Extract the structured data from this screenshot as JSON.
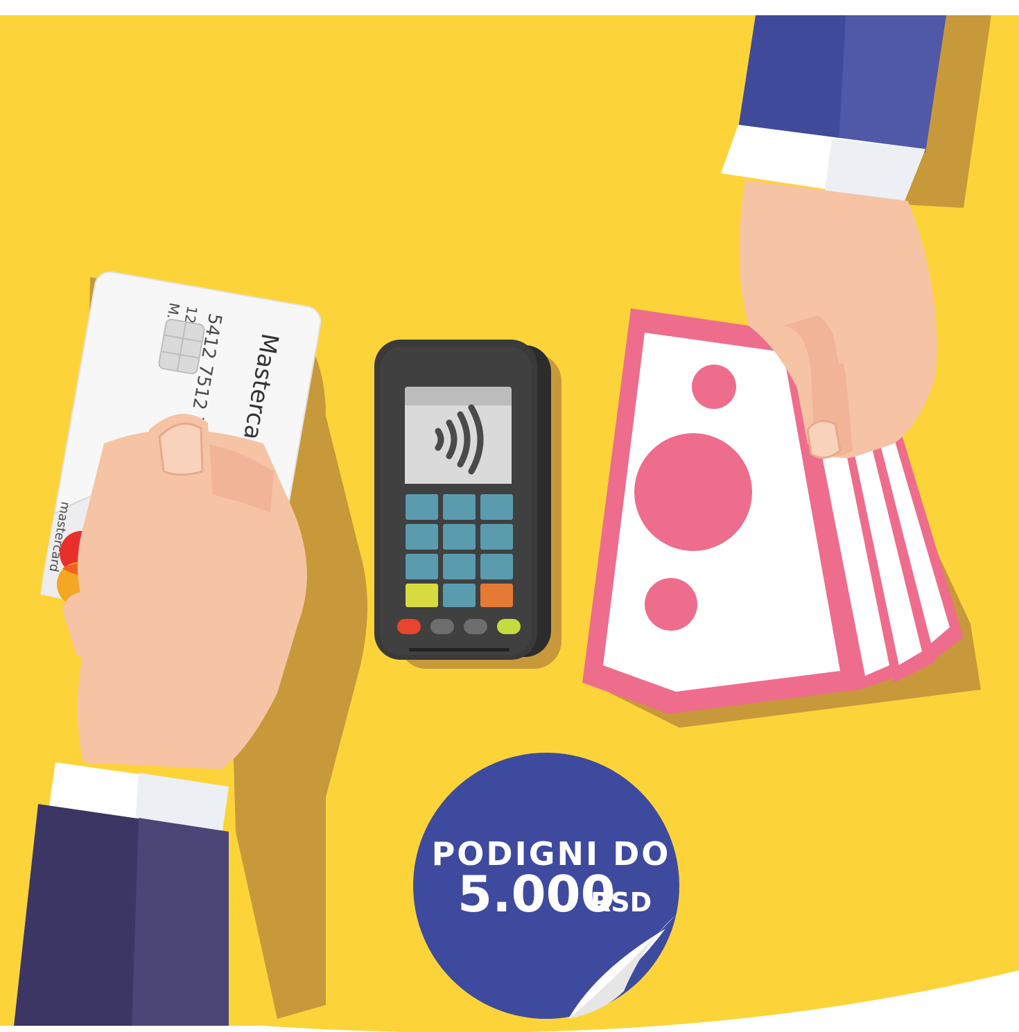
{
  "card": {
    "brand": "Mastercard",
    "number": "5412 7512 3412 3456",
    "expiry": "12/23",
    "holder": "M. Molina",
    "logo_text": "mastercard"
  },
  "badge": {
    "line1": "PODIGNI DO",
    "amount": "5.000",
    "currency": "RSD"
  },
  "terminal": {
    "icon": "contactless-icon"
  },
  "colors": {
    "background": "#FCD43A",
    "shadow": "#C8993A",
    "badge": "#3E4A9E",
    "cash": "#EE6D8C",
    "sleeve_left": "#3B3664",
    "sleeve_right": "#3F4A9A",
    "skin": "#F6C3A5"
  }
}
